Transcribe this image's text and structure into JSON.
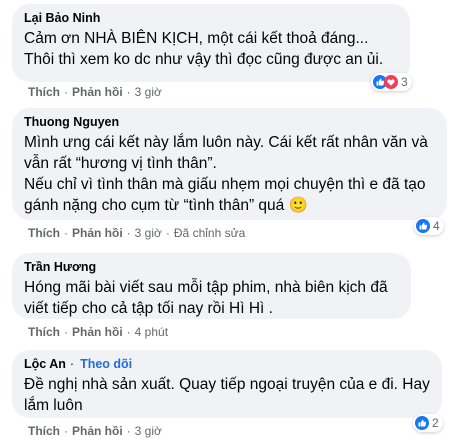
{
  "comments": [
    {
      "author": "Lại Bảo Ninh",
      "text": "Cảm ơn NHÀ BIÊN KỊCH, một cái kết thoả đáng...\nThôi thì xem ko dc như vậy thì đọc cũng được an ủi.",
      "like_label": "Thích",
      "reply_label": "Phản hồi",
      "time": "3 giờ",
      "reaction_count": "3",
      "reactions": [
        "like",
        "love"
      ]
    },
    {
      "author": "Thuong Nguyen",
      "text": "Mình ưng cái kết này lắm luôn này. Cái kết rất nhân văn và vẫn rất “hương vị tình thân”.\nNếu chỉ vì tình thân mà giấu nhẹm mọi chuyện thì e đã tạo gánh nặng cho cụm từ “tình thân” quá 🙂",
      "like_label": "Thích",
      "reply_label": "Phản hồi",
      "time": "3 giờ",
      "edited": "Đã chỉnh sửa",
      "reaction_count": "4",
      "reactions": [
        "like"
      ]
    },
    {
      "author": "Trần Hương",
      "text": "Hóng mãi bài viết sau mỗi tập phim, nhà biên kịch đã viết tiếp cho cả tập tối nay rồi Hì Hì .",
      "like_label": "Thích",
      "reply_label": "Phản hồi",
      "time": "4 phút"
    },
    {
      "author": "Lộc An",
      "follow_label": "Theo dõi",
      "text": "Đề nghị nhà sản xuất. Quay tiếp ngoại truyện của e đi. Hay lắm luôn",
      "like_label": "Thích",
      "reply_label": "Phản hồi",
      "time": "3 giờ",
      "reaction_count": "2",
      "reactions": [
        "like"
      ]
    }
  ],
  "colors": {
    "bubble": "#f0f2f5",
    "secondary_text": "#65676b",
    "like_blue": "#1877f2",
    "love_red": "#f33e58",
    "follow_blue": "#216fdb"
  }
}
